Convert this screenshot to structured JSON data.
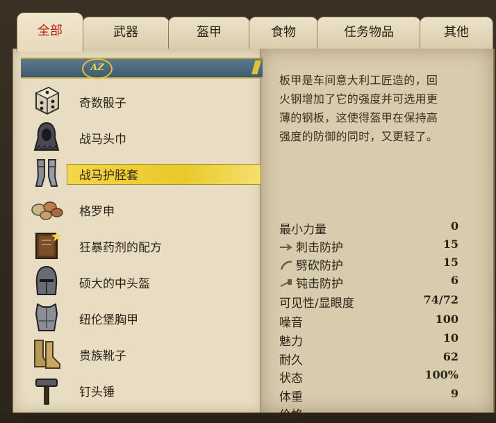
{
  "tabs": [
    {
      "label": "全部",
      "active": true
    },
    {
      "label": "武器"
    },
    {
      "label": "盔甲"
    },
    {
      "label": "食物"
    },
    {
      "label": "任务物品"
    },
    {
      "label": "其他"
    }
  ],
  "sort": {
    "label": "AZ"
  },
  "items": [
    {
      "name": "奇数骰子",
      "icon": "dice-icon"
    },
    {
      "name": "战马头巾",
      "icon": "hood-icon"
    },
    {
      "name": "战马护胫套",
      "icon": "greaves-icon",
      "selected": true
    },
    {
      "name": "格罗申",
      "icon": "coins-icon"
    },
    {
      "name": "狂暴药剂的配方",
      "icon": "recipe-book-icon"
    },
    {
      "name": "硕大的中头盔",
      "icon": "helmet-icon"
    },
    {
      "name": "纽伦堡胸甲",
      "icon": "breastplate-icon"
    },
    {
      "name": "贵族靴子",
      "icon": "boots-icon"
    },
    {
      "name": "钉头锤",
      "icon": "hammer-icon"
    }
  ],
  "description": "板甲是车间意大利工匠造的，回火钢增加了它的强度并可选用更薄的钢板，这使得盔甲在保持高强度的防御的同时，又更轻了。",
  "stats": [
    {
      "name": "最小力量",
      "value": "0"
    },
    {
      "name": "刺击防护",
      "value": "15",
      "icon": "stab-icon"
    },
    {
      "name": "劈砍防护",
      "value": "15",
      "icon": "slash-icon"
    },
    {
      "name": "钝击防护",
      "value": "6",
      "icon": "blunt-icon"
    },
    {
      "name": "可见性/显眼度",
      "value": "74/72"
    },
    {
      "name": "噪音",
      "value": "100"
    },
    {
      "name": "魅力",
      "value": "10"
    },
    {
      "name": "耐久",
      "value": "62"
    },
    {
      "name": "状态",
      "value": "100%"
    },
    {
      "name": "体重",
      "value": "9"
    },
    {
      "name": "价格",
      "value": ""
    }
  ]
}
